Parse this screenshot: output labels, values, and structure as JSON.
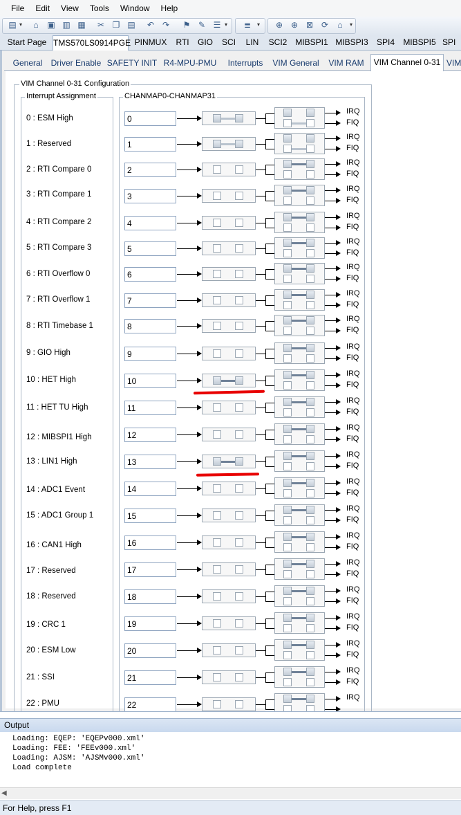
{
  "menu": [
    "File",
    "Edit",
    "View",
    "Tools",
    "Window",
    "Help"
  ],
  "tabs1": {
    "start": "Start Page",
    "device": "TMS570LS0914PGE",
    "pinmux": "PINMUX",
    "rti": "RTI",
    "gio": "GIO",
    "sci": "SCI",
    "lin": "LIN",
    "sci2": "SCI2",
    "mibspi1": "MIBSPI1",
    "mibspi3": "MIBSPI3",
    "spi4": "SPI4",
    "mibspi5": "MIBSPI5",
    "spi_partial": "SPI"
  },
  "tabs2": {
    "general": "General",
    "driver_enable": "Driver Enable",
    "safety_init": "SAFETY INIT",
    "mpu": "R4-MPU-PMU",
    "interrupts": "Interrupts",
    "vim_general": "VIM General",
    "vim_ram": "VIM RAM",
    "vim_channel": "VIM Channel 0-31",
    "vim_partial": "VIM"
  },
  "config": {
    "group_title": "VIM Channel 0-31 Configuration",
    "assign_title": "Interrupt Assignment",
    "chanmap_title": "CHANMAP0-CHANMAP31",
    "irq": "IRQ",
    "fiq": "FIQ"
  },
  "channels": [
    {
      "label": "0 : ESM High",
      "value": "0",
      "mode": "fiq-fixed"
    },
    {
      "label": "1 : Reserved",
      "value": "1",
      "mode": "fiq-fixed"
    },
    {
      "label": "2 : RTI Compare 0",
      "value": "2",
      "mode": "irq"
    },
    {
      "label": "3 : RTI Compare 1",
      "value": "3",
      "mode": "irq"
    },
    {
      "label": "4 : RTI Compare 2",
      "value": "4",
      "mode": "irq"
    },
    {
      "label": "5 : RTI Compare 3",
      "value": "5",
      "mode": "irq"
    },
    {
      "label": "6 : RTI Overflow 0",
      "value": "6",
      "mode": "irq"
    },
    {
      "label": "7 : RTI Overflow 1",
      "value": "7",
      "mode": "irq"
    },
    {
      "label": "8 : RTI Timebase 1",
      "value": "8",
      "mode": "irq"
    },
    {
      "label": "9 : GIO High",
      "value": "9",
      "mode": "irq"
    },
    {
      "label": "10 : HET High",
      "value": "10",
      "mode": "irq-enabled"
    },
    {
      "label": "11 : HET TU High",
      "value": "11",
      "mode": "irq"
    },
    {
      "label": "12 : MIBSPI1 High",
      "value": "12",
      "mode": "irq"
    },
    {
      "label": "13 : LIN1 High",
      "value": "13",
      "mode": "irq-enabled"
    },
    {
      "label": "14 : ADC1 Event",
      "value": "14",
      "mode": "irq"
    },
    {
      "label": "15 : ADC1 Group 1",
      "value": "15",
      "mode": "irq"
    },
    {
      "label": "16 : CAN1 High",
      "value": "16",
      "mode": "irq"
    },
    {
      "label": "17 : Reserved",
      "value": "17",
      "mode": "irq"
    },
    {
      "label": "18 : Reserved",
      "value": "18",
      "mode": "irq"
    },
    {
      "label": "19 : CRC 1",
      "value": "19",
      "mode": "irq"
    },
    {
      "label": "20 : ESM Low",
      "value": "20",
      "mode": "irq"
    },
    {
      "label": "21 : SSI",
      "value": "21",
      "mode": "irq"
    },
    {
      "label": "22 : PMU",
      "value": "22",
      "mode": "irq"
    }
  ],
  "output": {
    "title": "Output",
    "log": "Loading: EQEP: 'EQEPv000.xml'\nLoading: FEE: 'FEEv000.xml'\nLoading: AJSM: 'AJSMv000.xml'\nLoad complete"
  },
  "status": "For Help, press F1",
  "colors": {
    "annotation": "#e80000",
    "route": "#6f8197"
  },
  "icons": [
    "new-icon",
    "open-icon",
    "save-icon",
    "save-all-icon",
    "cut-icon",
    "copy-icon",
    "paste-icon",
    "undo-icon",
    "redo-icon",
    "generate-icon",
    "build-icon",
    "list-icon",
    "settings-icon",
    "nav-back-icon",
    "nav-forward-icon",
    "stop-icon",
    "refresh-icon",
    "home-icon"
  ]
}
